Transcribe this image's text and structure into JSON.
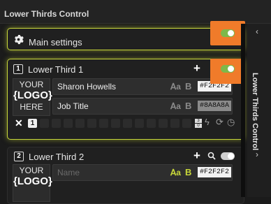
{
  "window": {
    "title": "Lower Thirds Control"
  },
  "main_settings": {
    "label": "Main settings",
    "enabled": true
  },
  "lower_thirds": [
    {
      "number": "1",
      "title": "Lower Third 1",
      "enabled": true,
      "logo": {
        "line1": "YOUR",
        "line2": "{LOGO}",
        "line3": "HERE"
      },
      "fields": [
        {
          "value": "Sharon Howells",
          "placeholder": "",
          "color": "#F2F2F2"
        },
        {
          "value": "Job Title",
          "placeholder": "",
          "color": "#8A8A8A"
        }
      ],
      "active_slot": "1",
      "counter_top": "3",
      "counter_bottom": "0"
    },
    {
      "number": "2",
      "title": "Lower Third 2",
      "enabled": false,
      "logo": {
        "line1": "YOUR",
        "line2": "{LOGO}"
      },
      "fields": [
        {
          "value": "",
          "placeholder": "Name",
          "color": "#F2F2F2"
        }
      ]
    }
  ],
  "sidebar": {
    "title": "Lower Thirds Control"
  },
  "icons": [
    "gear-icon",
    "plus-icon",
    "search-icon",
    "font-a-icon",
    "bold-icon",
    "close-icon",
    "bolt-icon",
    "refresh-icon",
    "clock-icon",
    "chevron-left-icon",
    "chevron-right-icon"
  ],
  "colors": {
    "accent": "#C7D63A",
    "toggle_on": "#7DB84A",
    "highlight": "#F07B2A"
  }
}
